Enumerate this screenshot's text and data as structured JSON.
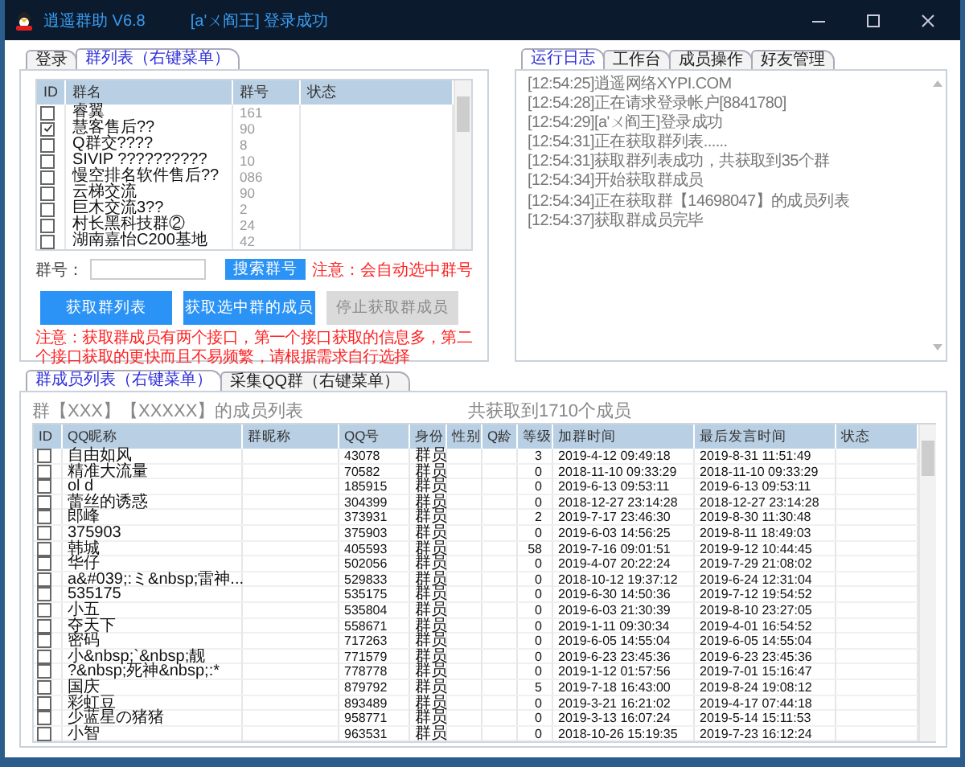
{
  "window": {
    "title": "逍遥群助 V6.8",
    "status": "[a'ㄨ阎王] 登录成功"
  },
  "left_panel": {
    "tabs": [
      {
        "label": "登录",
        "selected": false
      },
      {
        "label": "群列表（右键菜单）",
        "selected": true
      }
    ],
    "group_table": {
      "columns": [
        "ID",
        "群名",
        "群号",
        "状态"
      ],
      "rows": [
        {
          "checked": false,
          "name": "睿翼",
          "number": "161"
        },
        {
          "checked": true,
          "name": "慧客售后??",
          "number": "90"
        },
        {
          "checked": false,
          "name": "Q群交????",
          "number": "8"
        },
        {
          "checked": false,
          "name": "SIVIP ??????????",
          "number": "10"
        },
        {
          "checked": false,
          "name": "慢空排名软件售后??",
          "number": "086"
        },
        {
          "checked": false,
          "name": "云梯交流",
          "number": "90"
        },
        {
          "checked": false,
          "name": "巨木交流3??",
          "number": "2"
        },
        {
          "checked": false,
          "name": "村长黑科技群②",
          "number": "24"
        },
        {
          "checked": false,
          "name": "湖南嘉怡C200基地",
          "number": "42"
        }
      ]
    },
    "search": {
      "label": "群号：",
      "button": "搜索群号",
      "note": "注意：会自动选中群号"
    },
    "buttons": [
      {
        "label": "获取群列表",
        "disabled": false
      },
      {
        "label": "获取选中群的成员",
        "disabled": false
      },
      {
        "label": "停止获取群成员",
        "disabled": true
      }
    ],
    "note": "注意：获取群成员有两个接口，第一个接口获取的信息多，第二个接口获取的更快而且不易频繁，请根据需求自行选择"
  },
  "log_panel": {
    "tabs": [
      {
        "label": "运行日志",
        "selected": true
      },
      {
        "label": "工作台",
        "selected": false
      },
      {
        "label": "成员操作",
        "selected": false
      },
      {
        "label": "好友管理",
        "selected": false
      }
    ],
    "lines": [
      "[12:54:25]逍遥网络XYPI.COM",
      "[12:54:28]正在请求登录帐户[8841780]",
      "[12:54:29][a'ㄨ阎王]登录成功",
      "[12:54:31]正在获取群列表......",
      "[12:54:31]获取群列表成功，共获取到35个群",
      "[12:54:34]开始获取群成员",
      "[12:54:34]正在获取群【14698047】的成员列表",
      "[12:54:37]获取群成员完毕"
    ]
  },
  "member_panel": {
    "tabs": [
      {
        "label": "群成员列表（右键菜单）",
        "selected": true
      },
      {
        "label": "采集QQ群（右键菜单）",
        "selected": false
      }
    ],
    "title": "群【XXX】【XXXXX】的成员列表",
    "count": "共获取到1710个成员",
    "table": {
      "columns": [
        "ID",
        "QQ昵称",
        "群昵称",
        "QQ号",
        "身份",
        "性别",
        "Q龄",
        "等级",
        "加群时间",
        "最后发言时间",
        "状态"
      ],
      "rows": [
        {
          "checked": false,
          "nickname": "自由如风",
          "qq": "43078",
          "role": "群员",
          "level": "3",
          "joined": "2019-4-12 09:49:18",
          "last_spoke": "2019-8-31 11:51:49"
        },
        {
          "checked": false,
          "nickname": "精准大流量",
          "qq": "70582",
          "role": "群员",
          "level": "0",
          "joined": "2018-11-10 09:33:29",
          "last_spoke": "2018-11-10 09:33:29"
        },
        {
          "checked": false,
          "nickname": "ol d",
          "qq": "185915",
          "role": "群员",
          "level": "0",
          "joined": "2019-6-13 09:53:11",
          "last_spoke": "2019-6-13 09:53:11"
        },
        {
          "checked": false,
          "nickname": "蕾丝的诱惑",
          "qq": "304399",
          "role": "群员",
          "level": "0",
          "joined": "2018-12-27 23:14:28",
          "last_spoke": "2018-12-27 23:14:28"
        },
        {
          "checked": false,
          "nickname": "郎峰",
          "qq": "373931",
          "role": "群员",
          "level": "2",
          "joined": "2019-7-17 23:46:30",
          "last_spoke": "2019-8-30 11:30:48"
        },
        {
          "checked": false,
          "nickname": "375903",
          "qq": "375903",
          "role": "群员",
          "level": "0",
          "joined": "2019-6-03 14:56:25",
          "last_spoke": "2019-8-11 18:49:03"
        },
        {
          "checked": false,
          "nickname": "韩城",
          "qq": "405593",
          "role": "群员",
          "level": "58",
          "joined": "2019-7-16 09:01:51",
          "last_spoke": "2019-9-12 10:44:45"
        },
        {
          "checked": false,
          "nickname": "华仔",
          "qq": "502056",
          "role": "群员",
          "level": "0",
          "joined": "2019-4-07 20:22:24",
          "last_spoke": "2019-7-29 21:08:02"
        },
        {
          "checked": false,
          "nickname": "a&#039;:ミ&nbsp;雷神...",
          "qq": "529833",
          "role": "群员",
          "level": "0",
          "joined": "2018-10-12 19:37:12",
          "last_spoke": "2019-6-24 12:31:04"
        },
        {
          "checked": false,
          "nickname": "535175",
          "qq": "535175",
          "role": "群员",
          "level": "0",
          "joined": "2019-6-30 14:50:36",
          "last_spoke": "2019-7-12 19:54:52"
        },
        {
          "checked": false,
          "nickname": "小五",
          "qq": "535804",
          "role": "群员",
          "level": "0",
          "joined": "2019-6-03 21:30:39",
          "last_spoke": "2019-8-10 23:27:05"
        },
        {
          "checked": false,
          "nickname": "夺天下",
          "qq": "558671",
          "role": "群员",
          "level": "0",
          "joined": "2019-1-11 09:30:34",
          "last_spoke": "2019-4-01 16:54:52"
        },
        {
          "checked": false,
          "nickname": "密码",
          "qq": "717263",
          "role": "群员",
          "level": "0",
          "joined": "2019-6-05 14:55:04",
          "last_spoke": "2019-6-05 14:55:04"
        },
        {
          "checked": false,
          "nickname": "小&nbsp;`&nbsp;靓",
          "qq": "771579",
          "role": "群员",
          "level": "0",
          "joined": "2019-6-23 23:45:36",
          "last_spoke": "2019-6-23 23:45:36"
        },
        {
          "checked": false,
          "nickname": "?&nbsp;死神&nbsp;:*",
          "qq": "778778",
          "role": "群员",
          "level": "0",
          "joined": "2019-1-12 01:57:56",
          "last_spoke": "2019-7-01 15:16:47"
        },
        {
          "checked": false,
          "nickname": "国庆",
          "qq": "879792",
          "role": "群员",
          "level": "5",
          "joined": "2019-7-18 16:43:00",
          "last_spoke": "2019-8-24 19:08:12"
        },
        {
          "checked": false,
          "nickname": "彩虹豆",
          "qq": "893489",
          "role": "群员",
          "level": "0",
          "joined": "2019-3-21 16:21:02",
          "last_spoke": "2019-4-17 07:44:18"
        },
        {
          "checked": false,
          "nickname": "少蓝星の猪猪",
          "qq": "958771",
          "role": "群员",
          "level": "0",
          "joined": "2019-3-13 16:07:24",
          "last_spoke": "2019-5-14 15:11:53"
        },
        {
          "checked": false,
          "nickname": "小智",
          "qq": "963531",
          "role": "群员",
          "level": "0",
          "joined": "2018-10-26 15:19:35",
          "last_spoke": "2019-7-23 16:12:24"
        }
      ]
    }
  }
}
